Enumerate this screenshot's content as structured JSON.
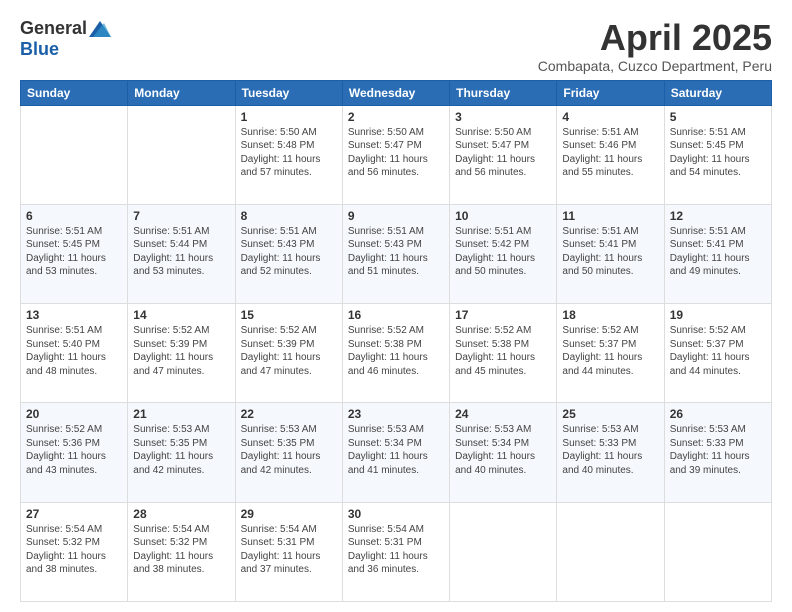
{
  "header": {
    "logo_general": "General",
    "logo_blue": "Blue",
    "month_title": "April 2025",
    "location": "Combapata, Cuzco Department, Peru"
  },
  "days_of_week": [
    "Sunday",
    "Monday",
    "Tuesday",
    "Wednesday",
    "Thursday",
    "Friday",
    "Saturday"
  ],
  "weeks": [
    [
      {
        "day": "",
        "info": ""
      },
      {
        "day": "",
        "info": ""
      },
      {
        "day": "1",
        "info": "Sunrise: 5:50 AM\nSunset: 5:48 PM\nDaylight: 11 hours and 57 minutes."
      },
      {
        "day": "2",
        "info": "Sunrise: 5:50 AM\nSunset: 5:47 PM\nDaylight: 11 hours and 56 minutes."
      },
      {
        "day": "3",
        "info": "Sunrise: 5:50 AM\nSunset: 5:47 PM\nDaylight: 11 hours and 56 minutes."
      },
      {
        "day": "4",
        "info": "Sunrise: 5:51 AM\nSunset: 5:46 PM\nDaylight: 11 hours and 55 minutes."
      },
      {
        "day": "5",
        "info": "Sunrise: 5:51 AM\nSunset: 5:45 PM\nDaylight: 11 hours and 54 minutes."
      }
    ],
    [
      {
        "day": "6",
        "info": "Sunrise: 5:51 AM\nSunset: 5:45 PM\nDaylight: 11 hours and 53 minutes."
      },
      {
        "day": "7",
        "info": "Sunrise: 5:51 AM\nSunset: 5:44 PM\nDaylight: 11 hours and 53 minutes."
      },
      {
        "day": "8",
        "info": "Sunrise: 5:51 AM\nSunset: 5:43 PM\nDaylight: 11 hours and 52 minutes."
      },
      {
        "day": "9",
        "info": "Sunrise: 5:51 AM\nSunset: 5:43 PM\nDaylight: 11 hours and 51 minutes."
      },
      {
        "day": "10",
        "info": "Sunrise: 5:51 AM\nSunset: 5:42 PM\nDaylight: 11 hours and 50 minutes."
      },
      {
        "day": "11",
        "info": "Sunrise: 5:51 AM\nSunset: 5:41 PM\nDaylight: 11 hours and 50 minutes."
      },
      {
        "day": "12",
        "info": "Sunrise: 5:51 AM\nSunset: 5:41 PM\nDaylight: 11 hours and 49 minutes."
      }
    ],
    [
      {
        "day": "13",
        "info": "Sunrise: 5:51 AM\nSunset: 5:40 PM\nDaylight: 11 hours and 48 minutes."
      },
      {
        "day": "14",
        "info": "Sunrise: 5:52 AM\nSunset: 5:39 PM\nDaylight: 11 hours and 47 minutes."
      },
      {
        "day": "15",
        "info": "Sunrise: 5:52 AM\nSunset: 5:39 PM\nDaylight: 11 hours and 47 minutes."
      },
      {
        "day": "16",
        "info": "Sunrise: 5:52 AM\nSunset: 5:38 PM\nDaylight: 11 hours and 46 minutes."
      },
      {
        "day": "17",
        "info": "Sunrise: 5:52 AM\nSunset: 5:38 PM\nDaylight: 11 hours and 45 minutes."
      },
      {
        "day": "18",
        "info": "Sunrise: 5:52 AM\nSunset: 5:37 PM\nDaylight: 11 hours and 44 minutes."
      },
      {
        "day": "19",
        "info": "Sunrise: 5:52 AM\nSunset: 5:37 PM\nDaylight: 11 hours and 44 minutes."
      }
    ],
    [
      {
        "day": "20",
        "info": "Sunrise: 5:52 AM\nSunset: 5:36 PM\nDaylight: 11 hours and 43 minutes."
      },
      {
        "day": "21",
        "info": "Sunrise: 5:53 AM\nSunset: 5:35 PM\nDaylight: 11 hours and 42 minutes."
      },
      {
        "day": "22",
        "info": "Sunrise: 5:53 AM\nSunset: 5:35 PM\nDaylight: 11 hours and 42 minutes."
      },
      {
        "day": "23",
        "info": "Sunrise: 5:53 AM\nSunset: 5:34 PM\nDaylight: 11 hours and 41 minutes."
      },
      {
        "day": "24",
        "info": "Sunrise: 5:53 AM\nSunset: 5:34 PM\nDaylight: 11 hours and 40 minutes."
      },
      {
        "day": "25",
        "info": "Sunrise: 5:53 AM\nSunset: 5:33 PM\nDaylight: 11 hours and 40 minutes."
      },
      {
        "day": "26",
        "info": "Sunrise: 5:53 AM\nSunset: 5:33 PM\nDaylight: 11 hours and 39 minutes."
      }
    ],
    [
      {
        "day": "27",
        "info": "Sunrise: 5:54 AM\nSunset: 5:32 PM\nDaylight: 11 hours and 38 minutes."
      },
      {
        "day": "28",
        "info": "Sunrise: 5:54 AM\nSunset: 5:32 PM\nDaylight: 11 hours and 38 minutes."
      },
      {
        "day": "29",
        "info": "Sunrise: 5:54 AM\nSunset: 5:31 PM\nDaylight: 11 hours and 37 minutes."
      },
      {
        "day": "30",
        "info": "Sunrise: 5:54 AM\nSunset: 5:31 PM\nDaylight: 11 hours and 36 minutes."
      },
      {
        "day": "",
        "info": ""
      },
      {
        "day": "",
        "info": ""
      },
      {
        "day": "",
        "info": ""
      }
    ]
  ]
}
